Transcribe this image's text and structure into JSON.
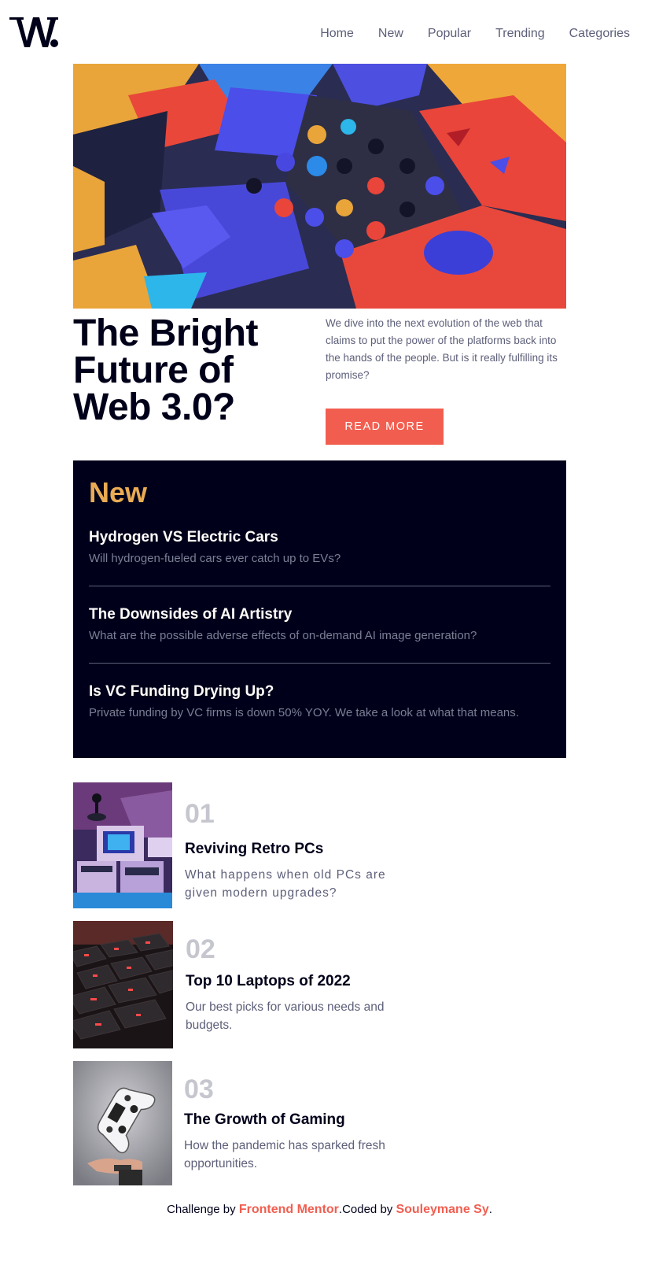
{
  "header": {
    "logo_icon": "w-logo",
    "nav": [
      "Home",
      "New",
      "Popular",
      "Trending",
      "Categories"
    ]
  },
  "hero": {
    "title": "The Bright Future of Web 3.0?",
    "description": "We dive into the next evolution of the web that claims to put the power of the platforms back into the hands of the people. But is it really fulfilling its promise?",
    "button_label": "READ MORE"
  },
  "new_section": {
    "heading": "New",
    "items": [
      {
        "title": "Hydrogen VS Electric Cars",
        "description": "Will hydrogen-fueled cars ever catch up to EVs?"
      },
      {
        "title": "The Downsides of AI Artistry",
        "description": "What are the possible adverse effects of on-demand AI image generation?"
      },
      {
        "title": "Is VC Funding Drying Up?",
        "description": "Private funding by VC firms is down 50% YOY. We take a look at what that means."
      }
    ]
  },
  "articles": [
    {
      "number": "01",
      "title": "Reviving Retro PCs",
      "description": "What happens when old PCs are given modern upgrades?"
    },
    {
      "number": "02",
      "title": "Top 10 Laptops of 2022",
      "description": "Our best picks for various needs and budgets."
    },
    {
      "number": "03",
      "title": "The Growth of Gaming",
      "description": "How the pandemic has sparked fresh opportunities."
    }
  ],
  "footer": {
    "prefix": "Challenge by ",
    "challenge_link": "Frontend Mentor",
    "middle": ".Coded by ",
    "author_link": "Souleymane Sy",
    "suffix": "."
  },
  "colors": {
    "accent": "#f15e50",
    "new_heading": "#e9ab53",
    "dark": "#00001a",
    "muted": "#5d5f79"
  }
}
